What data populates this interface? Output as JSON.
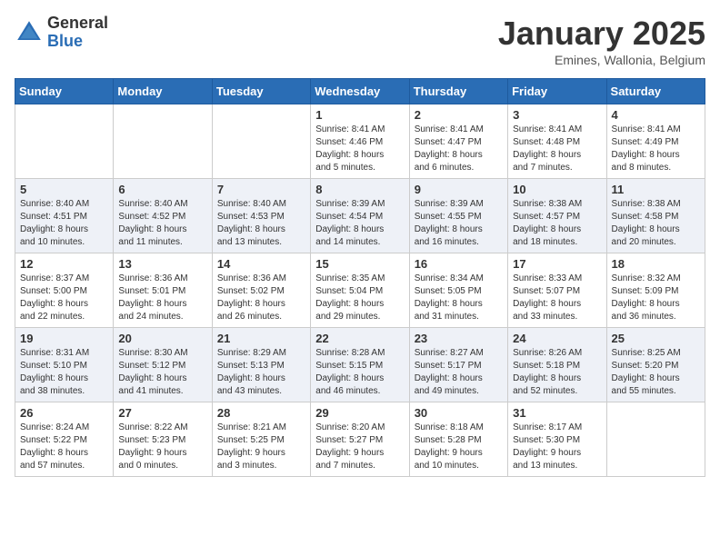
{
  "header": {
    "logo_general": "General",
    "logo_blue": "Blue",
    "title": "January 2025",
    "subtitle": "Emines, Wallonia, Belgium"
  },
  "weekdays": [
    "Sunday",
    "Monday",
    "Tuesday",
    "Wednesday",
    "Thursday",
    "Friday",
    "Saturday"
  ],
  "weeks": [
    [
      {
        "day": "",
        "info": ""
      },
      {
        "day": "",
        "info": ""
      },
      {
        "day": "",
        "info": ""
      },
      {
        "day": "1",
        "info": "Sunrise: 8:41 AM\nSunset: 4:46 PM\nDaylight: 8 hours\nand 5 minutes."
      },
      {
        "day": "2",
        "info": "Sunrise: 8:41 AM\nSunset: 4:47 PM\nDaylight: 8 hours\nand 6 minutes."
      },
      {
        "day": "3",
        "info": "Sunrise: 8:41 AM\nSunset: 4:48 PM\nDaylight: 8 hours\nand 7 minutes."
      },
      {
        "day": "4",
        "info": "Sunrise: 8:41 AM\nSunset: 4:49 PM\nDaylight: 8 hours\nand 8 minutes."
      }
    ],
    [
      {
        "day": "5",
        "info": "Sunrise: 8:40 AM\nSunset: 4:51 PM\nDaylight: 8 hours\nand 10 minutes."
      },
      {
        "day": "6",
        "info": "Sunrise: 8:40 AM\nSunset: 4:52 PM\nDaylight: 8 hours\nand 11 minutes."
      },
      {
        "day": "7",
        "info": "Sunrise: 8:40 AM\nSunset: 4:53 PM\nDaylight: 8 hours\nand 13 minutes."
      },
      {
        "day": "8",
        "info": "Sunrise: 8:39 AM\nSunset: 4:54 PM\nDaylight: 8 hours\nand 14 minutes."
      },
      {
        "day": "9",
        "info": "Sunrise: 8:39 AM\nSunset: 4:55 PM\nDaylight: 8 hours\nand 16 minutes."
      },
      {
        "day": "10",
        "info": "Sunrise: 8:38 AM\nSunset: 4:57 PM\nDaylight: 8 hours\nand 18 minutes."
      },
      {
        "day": "11",
        "info": "Sunrise: 8:38 AM\nSunset: 4:58 PM\nDaylight: 8 hours\nand 20 minutes."
      }
    ],
    [
      {
        "day": "12",
        "info": "Sunrise: 8:37 AM\nSunset: 5:00 PM\nDaylight: 8 hours\nand 22 minutes."
      },
      {
        "day": "13",
        "info": "Sunrise: 8:36 AM\nSunset: 5:01 PM\nDaylight: 8 hours\nand 24 minutes."
      },
      {
        "day": "14",
        "info": "Sunrise: 8:36 AM\nSunset: 5:02 PM\nDaylight: 8 hours\nand 26 minutes."
      },
      {
        "day": "15",
        "info": "Sunrise: 8:35 AM\nSunset: 5:04 PM\nDaylight: 8 hours\nand 29 minutes."
      },
      {
        "day": "16",
        "info": "Sunrise: 8:34 AM\nSunset: 5:05 PM\nDaylight: 8 hours\nand 31 minutes."
      },
      {
        "day": "17",
        "info": "Sunrise: 8:33 AM\nSunset: 5:07 PM\nDaylight: 8 hours\nand 33 minutes."
      },
      {
        "day": "18",
        "info": "Sunrise: 8:32 AM\nSunset: 5:09 PM\nDaylight: 8 hours\nand 36 minutes."
      }
    ],
    [
      {
        "day": "19",
        "info": "Sunrise: 8:31 AM\nSunset: 5:10 PM\nDaylight: 8 hours\nand 38 minutes."
      },
      {
        "day": "20",
        "info": "Sunrise: 8:30 AM\nSunset: 5:12 PM\nDaylight: 8 hours\nand 41 minutes."
      },
      {
        "day": "21",
        "info": "Sunrise: 8:29 AM\nSunset: 5:13 PM\nDaylight: 8 hours\nand 43 minutes."
      },
      {
        "day": "22",
        "info": "Sunrise: 8:28 AM\nSunset: 5:15 PM\nDaylight: 8 hours\nand 46 minutes."
      },
      {
        "day": "23",
        "info": "Sunrise: 8:27 AM\nSunset: 5:17 PM\nDaylight: 8 hours\nand 49 minutes."
      },
      {
        "day": "24",
        "info": "Sunrise: 8:26 AM\nSunset: 5:18 PM\nDaylight: 8 hours\nand 52 minutes."
      },
      {
        "day": "25",
        "info": "Sunrise: 8:25 AM\nSunset: 5:20 PM\nDaylight: 8 hours\nand 55 minutes."
      }
    ],
    [
      {
        "day": "26",
        "info": "Sunrise: 8:24 AM\nSunset: 5:22 PM\nDaylight: 8 hours\nand 57 minutes."
      },
      {
        "day": "27",
        "info": "Sunrise: 8:22 AM\nSunset: 5:23 PM\nDaylight: 9 hours\nand 0 minutes."
      },
      {
        "day": "28",
        "info": "Sunrise: 8:21 AM\nSunset: 5:25 PM\nDaylight: 9 hours\nand 3 minutes."
      },
      {
        "day": "29",
        "info": "Sunrise: 8:20 AM\nSunset: 5:27 PM\nDaylight: 9 hours\nand 7 minutes."
      },
      {
        "day": "30",
        "info": "Sunrise: 8:18 AM\nSunset: 5:28 PM\nDaylight: 9 hours\nand 10 minutes."
      },
      {
        "day": "31",
        "info": "Sunrise: 8:17 AM\nSunset: 5:30 PM\nDaylight: 9 hours\nand 13 minutes."
      },
      {
        "day": "",
        "info": ""
      }
    ]
  ]
}
